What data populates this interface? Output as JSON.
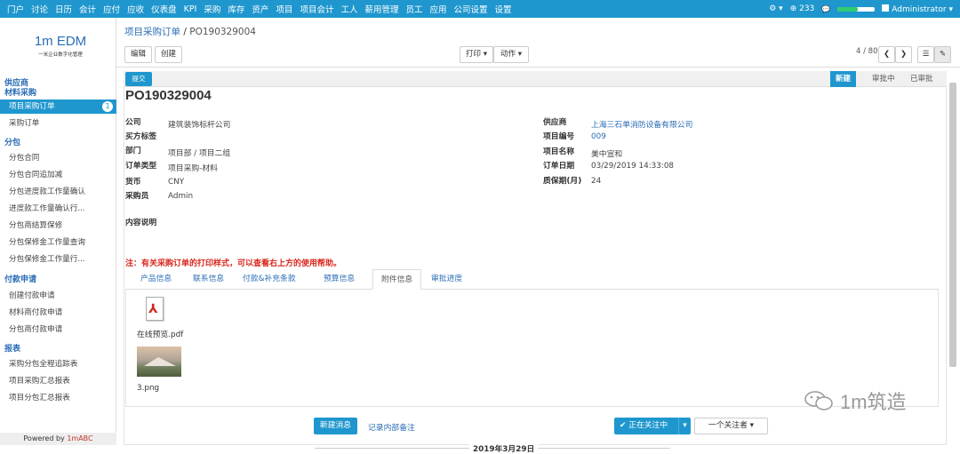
{
  "topbar": {
    "menu": [
      "门户",
      "讨论",
      "日历",
      "会计",
      "应付",
      "应收",
      "仪表盘",
      "KPI",
      "采购",
      "库存",
      "资产",
      "项目",
      "项目会计",
      "工人",
      "薪用管理",
      "员工",
      "应用",
      "公司设置",
      "设置"
    ],
    "settings_icon": "⚙ ▾",
    "badge_count": "233",
    "chat_icon": "💬",
    "user": "Administrator ▾"
  },
  "sidebar": {
    "logo_big": "1m EDM",
    "logo_small": "一米企业数字化管理",
    "sections": [
      {
        "head": "供应商"
      },
      {
        "head": "材料采购"
      },
      {
        "active_item": "项目采购订单",
        "badge": "1"
      },
      {
        "item": "采购订单"
      },
      {
        "head": "分包"
      },
      {
        "item": "分包合同"
      },
      {
        "item": "分包合同追加减"
      },
      {
        "item": "分包进度款工作量确认"
      },
      {
        "item": "进度款工作量确认行..."
      },
      {
        "item": "分包商结算保修"
      },
      {
        "item": "分包保修金工作量查询"
      },
      {
        "item": "分包保修金工作量行..."
      },
      {
        "head": "付款申请"
      },
      {
        "item": "创建付款申请"
      },
      {
        "item": "材料商付款申请"
      },
      {
        "item": "分包商付款申请"
      },
      {
        "head": "报表"
      },
      {
        "item": "采购分包全程追踪表"
      },
      {
        "item": "项目采购汇总报表"
      },
      {
        "item": "项目分包汇总报表"
      }
    ],
    "powered_prefix": "Powered by ",
    "powered_brand": "1mABC"
  },
  "breadcrumb": {
    "parent": "项目采购订单",
    "sep": "/",
    "current": "PO190329004"
  },
  "toolbar": {
    "edit": "编辑",
    "create": "创建",
    "print": "打印 ▾",
    "action": "动作 ▾",
    "pager": "4 / 80",
    "prev": "❮",
    "next": "❯",
    "list_icon": "☰",
    "form_icon": "✎"
  },
  "statusbar": {
    "submit": "提交",
    "steps": [
      "新建",
      "审批中",
      "已审批"
    ],
    "active_step": "新建"
  },
  "record": {
    "title": "PO190329004",
    "left": [
      {
        "label": "公司",
        "value": "建筑装饰标杆公司"
      },
      {
        "label": "买方标签",
        "value": ""
      },
      {
        "label": "部门",
        "value": "项目部 / 项目二组"
      },
      {
        "label": "订单类型",
        "value": "项目采购-材料"
      },
      {
        "label": "货币",
        "value": "CNY"
      },
      {
        "label": "采购员",
        "value": "Admin"
      },
      {
        "label": "内容说明",
        "value": ""
      }
    ],
    "right": [
      {
        "label": "供应商",
        "value": "上海三石单消防设备有限公司"
      },
      {
        "label": "项目编号",
        "value": "009"
      },
      {
        "label": "项目名称",
        "value": "美中宣和"
      },
      {
        "label": "订单日期",
        "value": "03/29/2019 14:33:08"
      },
      {
        "label": "质保期(月)",
        "value": "24"
      }
    ],
    "note": "注：有关采购订单的打印样式，可以查看右上方的使用帮助。"
  },
  "tabs": [
    "产品信息",
    "联系信息",
    "付款&补充条款",
    "预算信息",
    "附件信息",
    "审批进度"
  ],
  "active_tab": "附件信息",
  "attachments": [
    {
      "name": "在线预览.pdf",
      "icon": "pdf-icon"
    },
    {
      "name": "3.png",
      "icon": "image-thumbnail"
    }
  ],
  "chatter": {
    "new_message": "新建消息",
    "log_note": "记录内部备注",
    "following": "✔ 正在关注中",
    "followers": "一个关注者 ▾",
    "date": "2019年3月29日"
  },
  "watermark": "1m筑造",
  "colors": {
    "primary": "#1f97ce",
    "link": "#2a6db5",
    "warning": "#d9261c"
  }
}
